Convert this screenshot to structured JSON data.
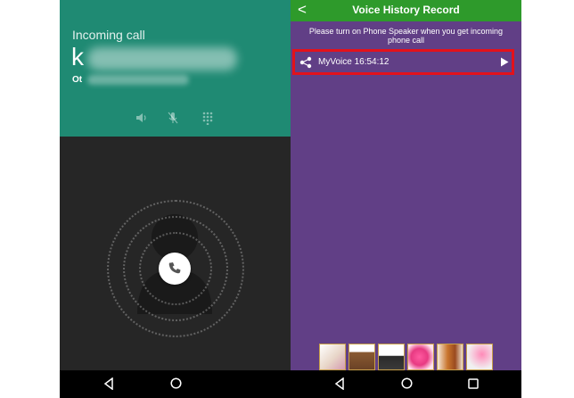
{
  "incoming_call": {
    "status_label": "Incoming call",
    "caller_initial": "k",
    "caller_sub_prefix": "Ot",
    "controls": [
      "speaker-icon",
      "mute-icon",
      "dialpad-icon"
    ],
    "answer_icon": "phone-icon"
  },
  "voice_history": {
    "back_icon": "back-arrow-icon",
    "back_glyph": "<",
    "title": "Voice History Record",
    "notice": "Please turn on Phone Speaker when you get incoming phone call",
    "records": [
      {
        "label": "MyVoice 16:54:12",
        "share_icon": "share-icon",
        "play_icon": "play-icon"
      }
    ]
  },
  "ad_thumbnails": [
    "stickers",
    "boot",
    "shoe",
    "hearts",
    "sandals",
    "jewelry"
  ],
  "navigation": [
    "back-icon",
    "home-icon",
    "recents-icon"
  ],
  "colors": {
    "call_teal": "#1f8a73",
    "call_dark": "#262626",
    "header_green": "#2e9a2b",
    "panel_purple": "#613f86",
    "highlight_red": "#e3121b"
  }
}
